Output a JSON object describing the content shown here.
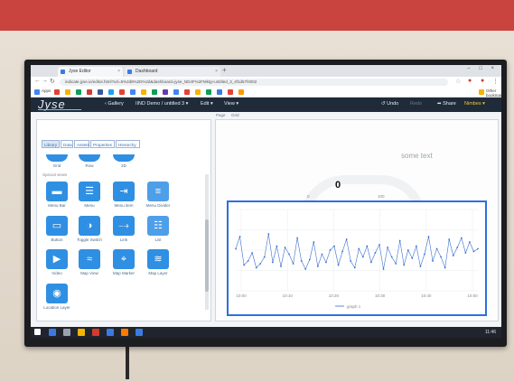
{
  "browser": {
    "tabs": [
      {
        "label": "Jyse Editor"
      },
      {
        "label": "Dashboard"
      }
    ],
    "new_tab": "+",
    "window_controls": "–  □  ×",
    "url": "indicate.jyse.io/editor.html?url=5%2d8%2D%2d&dashboard=jyse_ND4F%2FMktg+untitled_3_4f1d57f4002"
  },
  "bookmarks": [
    {
      "label": "Apps",
      "color": "#4285f4"
    },
    {
      "label": "",
      "color": "#e34234"
    },
    {
      "label": "",
      "color": "#f4b400"
    },
    {
      "label": "",
      "color": "#0f9d58"
    },
    {
      "label": "",
      "color": "#d23b2e"
    },
    {
      "label": "",
      "color": "#3b5998"
    },
    {
      "label": "",
      "color": "#1da1f2"
    },
    {
      "label": "",
      "color": "#e34234"
    },
    {
      "label": "",
      "color": "#4285f4"
    },
    {
      "label": "",
      "color": "#f4b400"
    },
    {
      "label": "",
      "color": "#0f9d58"
    },
    {
      "label": "",
      "color": "#673ab7"
    },
    {
      "label": "",
      "color": "#4285f4"
    },
    {
      "label": "",
      "color": "#e34234"
    },
    {
      "label": "",
      "color": "#f4b400"
    },
    {
      "label": "",
      "color": "#0f9d58"
    },
    {
      "label": "",
      "color": "#3b7be0"
    },
    {
      "label": "",
      "color": "#e34234"
    },
    {
      "label": "",
      "color": "#ff9800"
    },
    {
      "label": "Other bookmarks",
      "color": "#f4b400"
    }
  ],
  "appbar": {
    "logo": "Jyse",
    "gallery": "‹ Gallery",
    "dashboard": "IIND Demo / untitled 3 ▾",
    "edit": "Edit ▾",
    "view": "View ▾",
    "undo": "↺ Undo",
    "redo": "Redo",
    "share": "➦ Share",
    "user": "Nimbes ▾",
    "mini_tabs": [
      "Page",
      "Grid"
    ]
  },
  "library": {
    "tabs": [
      "Library",
      "Data",
      "Assets",
      "Properties",
      "Hierarchy"
    ],
    "top_row": [
      "Grid",
      "Row",
      "2D"
    ],
    "category": "Special views",
    "rows": [
      [
        {
          "label": "Menu Bar",
          "icon": "menu-bar-icon"
        },
        {
          "label": "Menu",
          "icon": "menu-icon"
        },
        {
          "label": "Menu item",
          "icon": "menu-item-icon"
        },
        {
          "label": "Menu Divider",
          "icon": "menu-divider-icon"
        }
      ],
      [
        {
          "label": "Button",
          "icon": "button-icon"
        },
        {
          "label": "Toggle Switch",
          "icon": "toggle-icon"
        },
        {
          "label": "Link",
          "icon": "link-icon"
        },
        {
          "label": "List",
          "icon": "list-icon"
        }
      ],
      [
        {
          "label": "Video",
          "icon": "play-icon"
        },
        {
          "label": "Map View",
          "icon": "map-view-icon"
        },
        {
          "label": "Map Marker",
          "icon": "map-marker-icon"
        },
        {
          "label": "Map Layer",
          "icon": "map-layer-icon"
        }
      ],
      [
        {
          "label": "Location Layer",
          "icon": "location-layer-icon"
        }
      ]
    ]
  },
  "canvas": {
    "some_text": "some text",
    "gauge": {
      "value": "0",
      "min": "0",
      "max": "100"
    }
  },
  "taskbar": {
    "clock": "11:46",
    "icons": [
      {
        "color": "#3b7be0"
      },
      {
        "color": "#9aa3ad"
      },
      {
        "color": "#f4b400"
      },
      {
        "color": "#d23b2e"
      },
      {
        "color": "#3b7be0"
      },
      {
        "color": "#ff7a00"
      },
      {
        "color": "#3b7be0"
      }
    ]
  },
  "chart_data": {
    "type": "line",
    "x_ticks": [
      "10:00",
      "10:10",
      "10:20",
      "10:30",
      "10:40",
      "10:50"
    ],
    "series": [
      {
        "name": "graph 1",
        "color": "#3b6fd0",
        "values": [
          61,
          70,
          49,
          52,
          58,
          47,
          50,
          55,
          72,
          51,
          63,
          48,
          62,
          57,
          50,
          69,
          52,
          46,
          53,
          66,
          48,
          57,
          51,
          60,
          63,
          49,
          59,
          68,
          52,
          47,
          61,
          55,
          63,
          51,
          58,
          64,
          46,
          62,
          55,
          50,
          67,
          49,
          60,
          54,
          63,
          48,
          57,
          70,
          52,
          61,
          55,
          47,
          68,
          56,
          62,
          69,
          58,
          66,
          59,
          61
        ]
      }
    ],
    "ylim": [
      30,
      90
    ],
    "grid": true,
    "legend": "bottom-center"
  }
}
